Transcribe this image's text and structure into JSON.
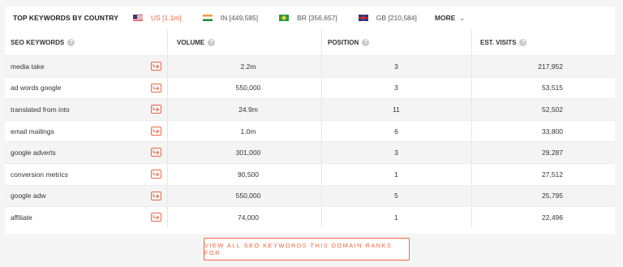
{
  "header": {
    "title": "TOP KEYWORDS BY COUNTRY",
    "countries": [
      {
        "code": "US",
        "count": "[1.1m]",
        "active": true
      },
      {
        "code": "IN",
        "count": "[449,585]",
        "active": false
      },
      {
        "code": "BR",
        "count": "[356,657]",
        "active": false
      },
      {
        "code": "GB",
        "count": "[210,584]",
        "active": false
      }
    ],
    "more_label": "MORE",
    "more_icon": "chevron-down-icon"
  },
  "columns": {
    "keyword": "SEO KEYWORDS",
    "volume": "VOLUME",
    "position": "POSITION",
    "visits": "EST. VISITS"
  },
  "rows": [
    {
      "keyword": "media take",
      "volume": "2.2m",
      "position": "3",
      "visits": "217,952"
    },
    {
      "keyword": "ad words google",
      "volume": "550,000",
      "position": "3",
      "visits": "53,515"
    },
    {
      "keyword": "translated from into",
      "volume": "24.9m",
      "position": "11",
      "visits": "52,502"
    },
    {
      "keyword": "email mailings",
      "volume": "1.0m",
      "position": "6",
      "visits": "33,800"
    },
    {
      "keyword": "google adverts",
      "volume": "301,000",
      "position": "3",
      "visits": "29,287"
    },
    {
      "keyword": "conversion metrics",
      "volume": "90,500",
      "position": "1",
      "visits": "27,512"
    },
    {
      "keyword": "google adw",
      "volume": "550,000",
      "position": "5",
      "visits": "25,795"
    },
    {
      "keyword": "affiliate",
      "volume": "74,000",
      "position": "1",
      "visits": "22,496"
    }
  ],
  "cta": {
    "label": "VIEW ALL SEO KEYWORDS THIS DOMAIN RANKS FOR"
  },
  "colors": {
    "accent": "#f0663f",
    "stripe": "#f4f4f4"
  }
}
